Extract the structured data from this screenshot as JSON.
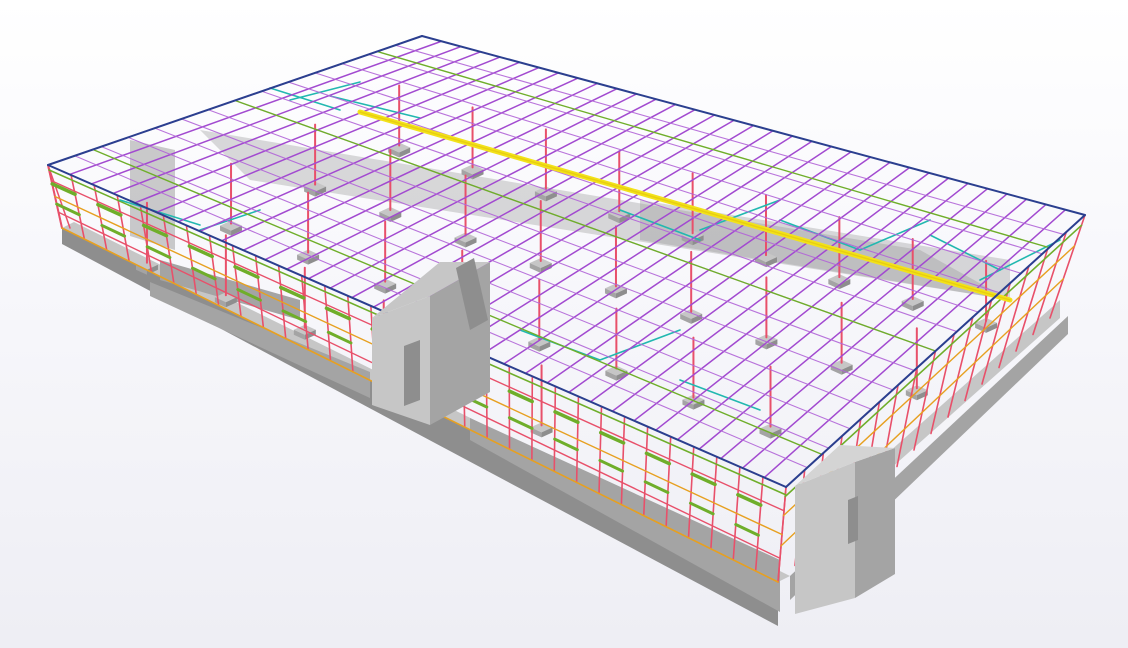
{
  "viewer": {
    "background_top": "#ffffff",
    "background_bottom": "#eeeef4"
  },
  "model": {
    "description_label": "",
    "colors": {
      "concrete": "#a4a4a4",
      "concrete_light": "#c6c6c6",
      "concrete_dark": "#8e8e8e",
      "column": "#e8506a",
      "roof_rafter": "#a24ad0",
      "purlin": "#b266d8",
      "edge_beam": "#2b3f8f",
      "bracing": "#22b8b0",
      "girt": "#6fae2a",
      "eave_strut": "#e7a020",
      "ridge_walkway": "#f2e21a"
    }
  }
}
